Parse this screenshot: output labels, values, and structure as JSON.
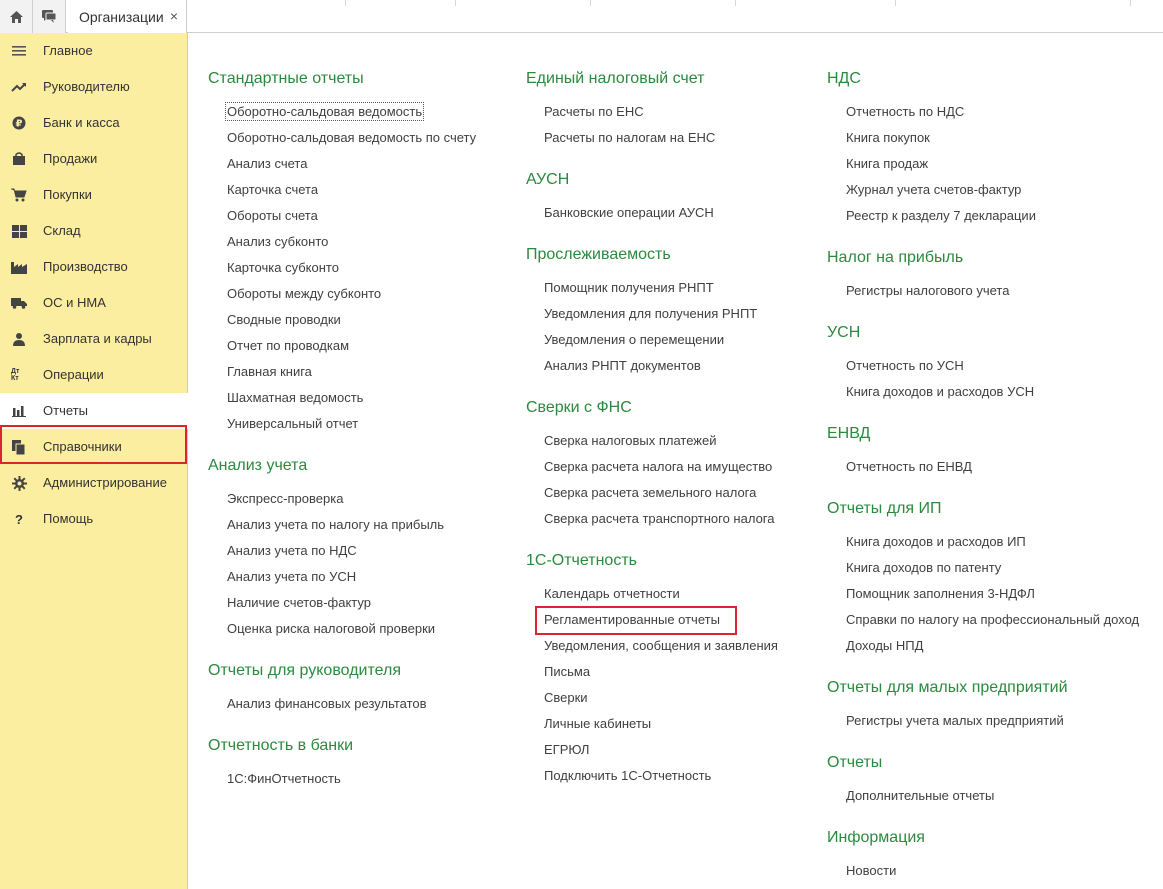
{
  "topbar": {
    "home_icon": "home-icon",
    "chat_icon": "chat-icon",
    "tab_label": "Организации",
    "tab_close": "×"
  },
  "sidebar": {
    "items": [
      {
        "label": "Главное",
        "icon": "menu-lines-icon"
      },
      {
        "label": "Руководителю",
        "icon": "trend-up-icon"
      },
      {
        "label": "Банк и касса",
        "icon": "ruble-coin-icon"
      },
      {
        "label": "Продажи",
        "icon": "shopping-bag-icon"
      },
      {
        "label": "Покупки",
        "icon": "cart-icon"
      },
      {
        "label": "Склад",
        "icon": "warehouse-grid-icon"
      },
      {
        "label": "Производство",
        "icon": "factory-icon"
      },
      {
        "label": "ОС и НМА",
        "icon": "truck-icon"
      },
      {
        "label": "Зарплата и кадры",
        "icon": "person-icon"
      },
      {
        "label": "Операции",
        "icon": "debit-credit-icon",
        "icon_text": "Дт Кт"
      },
      {
        "label": "Отчеты",
        "icon": "bar-chart-icon",
        "active": true
      },
      {
        "label": "Справочники",
        "icon": "books-icon"
      },
      {
        "label": "Администрирование",
        "icon": "gear-icon"
      },
      {
        "label": "Помощь",
        "icon": "question-icon",
        "icon_text": "?"
      }
    ]
  },
  "columns": [
    {
      "sections": [
        {
          "title": "Стандартные отчеты",
          "links": [
            "Оборотно-сальдовая ведомость",
            "Оборотно-сальдовая ведомость по счету",
            "Анализ счета",
            "Карточка счета",
            "Обороты счета",
            "Анализ субконто",
            "Карточка субконто",
            "Обороты между субконто",
            "Сводные проводки",
            "Отчет по проводкам",
            "Главная книга",
            "Шахматная ведомость",
            "Универсальный отчет"
          ]
        },
        {
          "title": "Анализ учета",
          "links": [
            "Экспресс-проверка",
            "Анализ учета по налогу на прибыль",
            "Анализ учета по НДС",
            "Анализ учета по УСН",
            "Наличие счетов-фактур",
            "Оценка риска налоговой проверки"
          ]
        },
        {
          "title": "Отчеты для руководителя",
          "links": [
            "Анализ финансовых результатов"
          ]
        },
        {
          "title": "Отчетность в банки",
          "links": [
            "1С:ФинОтчетность"
          ]
        }
      ]
    },
    {
      "sections": [
        {
          "title": "Единый налоговый счет",
          "links": [
            "Расчеты по ЕНС",
            "Расчеты по налогам на ЕНС"
          ]
        },
        {
          "title": "АУСН",
          "links": [
            "Банковские операции АУСН"
          ]
        },
        {
          "title": "Прослеживаемость",
          "links": [
            "Помощник получения РНПТ",
            "Уведомления для получения РНПТ",
            "Уведомления о перемещении",
            "Анализ РНПТ документов"
          ]
        },
        {
          "title": "Сверки с ФНС",
          "links": [
            "Сверка налоговых платежей",
            "Сверка расчета налога на имущество",
            "Сверка расчета земельного налога",
            "Сверка расчета транспортного налога"
          ]
        },
        {
          "title": "1С-Отчетность",
          "links": [
            "Календарь отчетности",
            "Регламентированные отчеты",
            "Уведомления, сообщения и заявления",
            "Письма",
            "Сверки",
            "Личные кабинеты",
            "ЕГРЮЛ",
            "Подключить 1С-Отчетность"
          ]
        }
      ]
    },
    {
      "sections": [
        {
          "title": "НДС",
          "links": [
            "Отчетность по НДС",
            "Книга покупок",
            "Книга продаж",
            "Журнал учета счетов-фактур",
            "Реестр к разделу 7 декларации"
          ]
        },
        {
          "title": "Налог на прибыль",
          "links": [
            "Регистры налогового учета"
          ]
        },
        {
          "title": "УСН",
          "links": [
            "Отчетность по УСН",
            "Книга доходов и расходов УСН"
          ]
        },
        {
          "title": "ЕНВД",
          "links": [
            "Отчетность по ЕНВД"
          ]
        },
        {
          "title": "Отчеты для ИП",
          "links": [
            "Книга доходов и расходов ИП",
            "Книга доходов по патенту",
            "Помощник заполнения 3-НДФЛ",
            "Справки по налогу на профессиональный доход",
            "Доходы НПД"
          ]
        },
        {
          "title": "Отчеты для малых предприятий",
          "links": [
            "Регистры учета малых предприятий"
          ]
        },
        {
          "title": "Отчеты",
          "links": [
            "Дополнительные отчеты"
          ]
        },
        {
          "title": "Информация",
          "links": [
            "Новости"
          ]
        }
      ]
    }
  ],
  "colors": {
    "sidebar_bg": "#fbeea0",
    "section_title": "#2b8a3e",
    "highlight_red": "#d9262f",
    "link_text": "#404040"
  }
}
